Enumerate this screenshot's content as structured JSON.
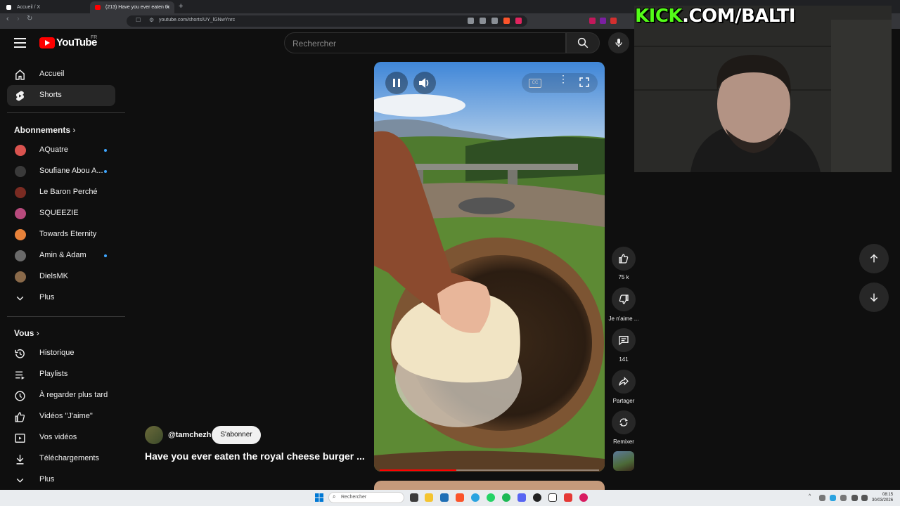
{
  "browser": {
    "tabs": [
      {
        "title": "Accueil / X"
      },
      {
        "title": "(213) Have you ever eaten th"
      }
    ],
    "url": "youtube.com/shorts/UY_lGNwYnrc"
  },
  "header": {
    "logo_text": "YouTube",
    "country": "FR",
    "search_placeholder": "Rechercher"
  },
  "sidebar": {
    "main": [
      {
        "label": "Accueil",
        "icon": "home-icon"
      },
      {
        "label": "Shorts",
        "icon": "shorts-icon",
        "active": true
      }
    ],
    "subscriptions_title": "Abonnements",
    "subscriptions": [
      {
        "label": "AQuatre",
        "dot": true,
        "color": "#d9534f"
      },
      {
        "label": "Soufiane Abou A...",
        "dot": true,
        "color": "#555555"
      },
      {
        "label": "Le Baron Perché",
        "dot": false,
        "color": "#7a2b22"
      },
      {
        "label": "SQUEEZIE",
        "dot": false,
        "color": "#b84a7d"
      },
      {
        "label": "Towards Eternity",
        "dot": false,
        "color": "#e8823a"
      },
      {
        "label": "Amin & Adam",
        "dot": true,
        "color": "#6a6a6a"
      },
      {
        "label": "DielsMK",
        "dot": false,
        "color": "#8a6a4a"
      }
    ],
    "subs_more": "Plus",
    "you_title": "Vous",
    "you": [
      {
        "label": "Historique",
        "icon": "history-icon"
      },
      {
        "label": "Playlists",
        "icon": "playlists-icon"
      },
      {
        "label": "À regarder plus tard",
        "icon": "watch-later-icon"
      },
      {
        "label": "Vidéos \"J'aime\"",
        "icon": "liked-videos-icon"
      },
      {
        "label": "Vos vidéos",
        "icon": "your-videos-icon"
      },
      {
        "label": "Téléchargements",
        "icon": "downloads-icon"
      }
    ],
    "you_more": "Plus"
  },
  "short": {
    "channel": "@tamchezh",
    "subscribe": "S'abonner",
    "title": "Have you ever eaten the royal cheese burger ...",
    "progress": 0.35
  },
  "actions": {
    "likes": "75 k",
    "dislike": "Je n'aime ...",
    "comments": "141",
    "share": "Partager",
    "remix": "Remixer"
  },
  "overlay": {
    "kick_prefix": "KICK",
    "kick_suffix": ".COM/BALTI"
  },
  "taskbar": {
    "search_placeholder": "Rechercher",
    "time": "08:15",
    "date": "30/03/2026"
  }
}
